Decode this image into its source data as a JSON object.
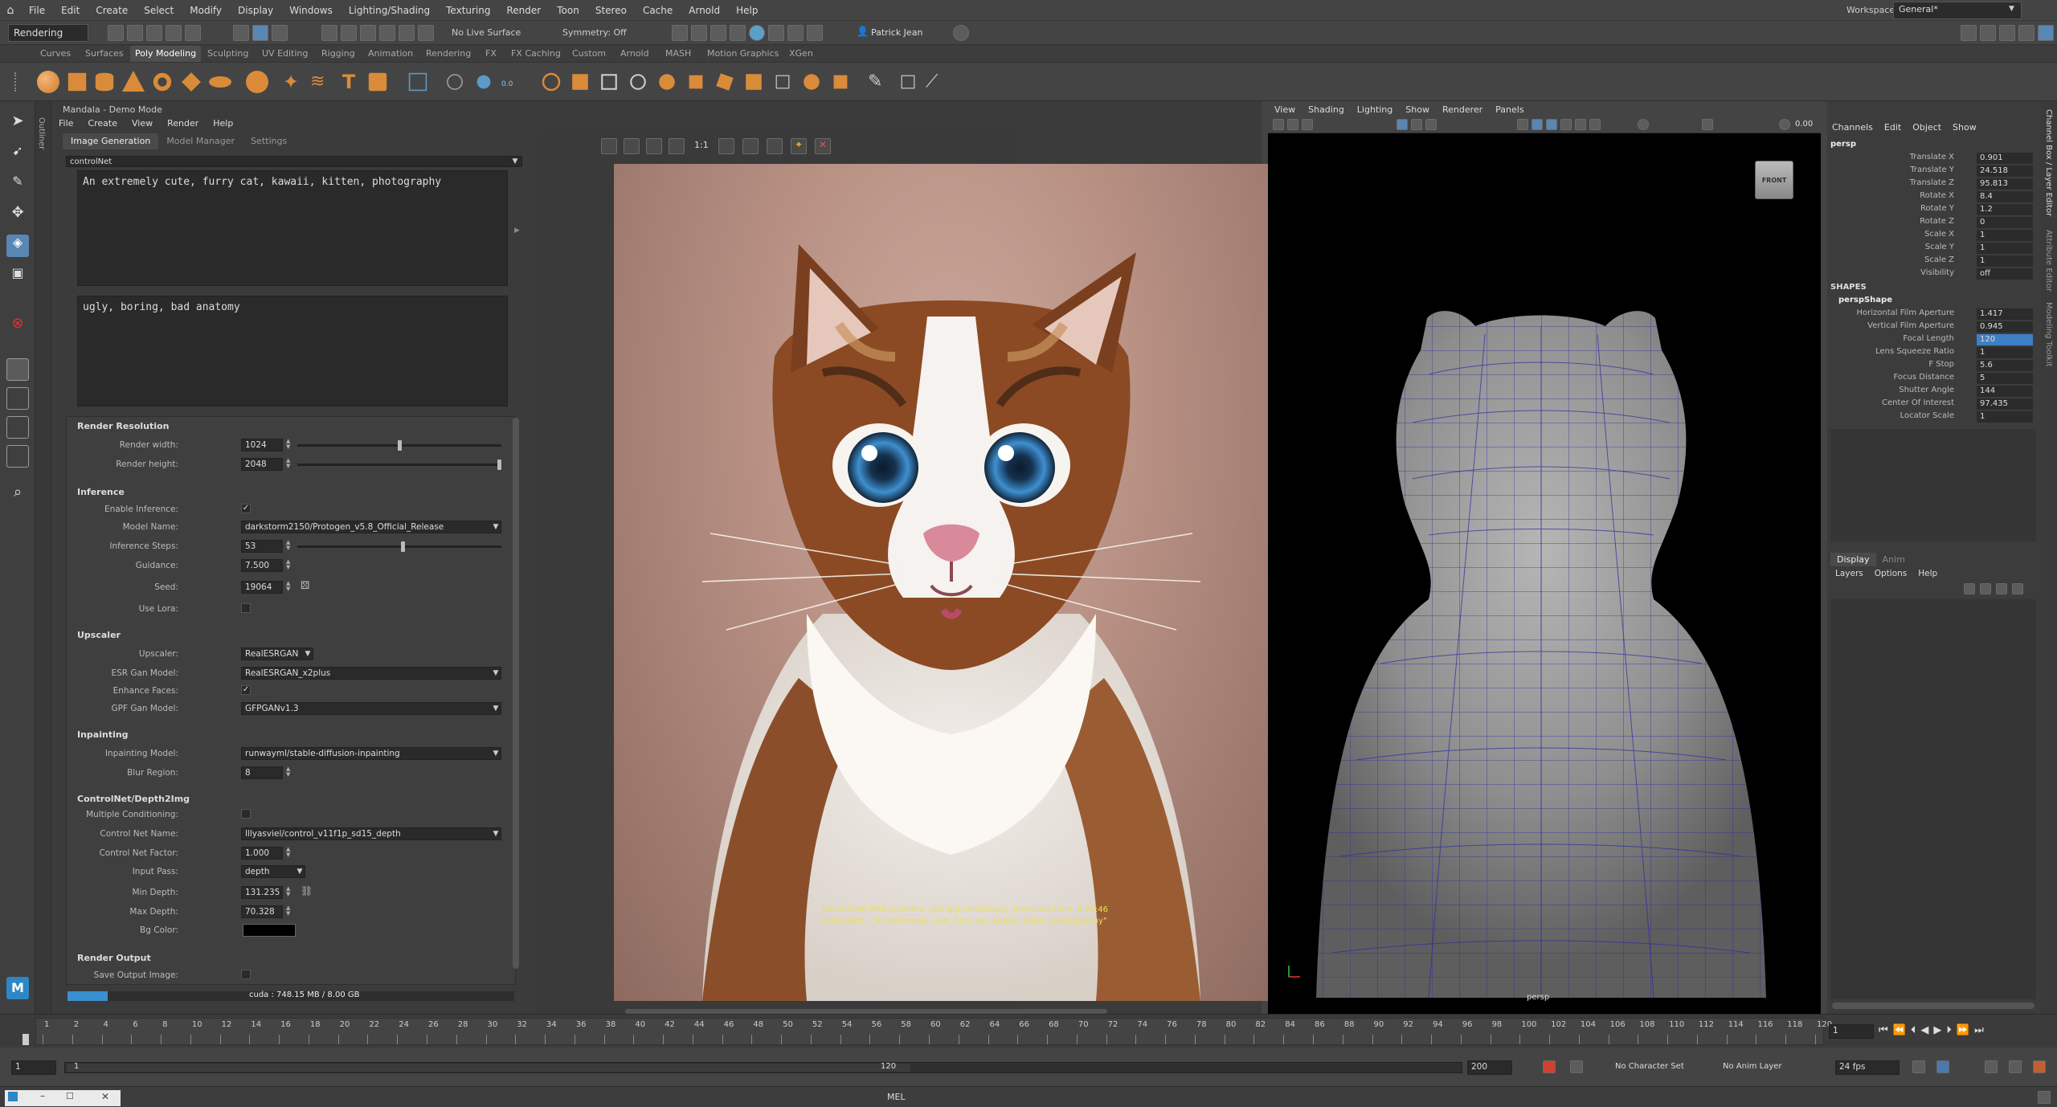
{
  "app": {
    "menu": [
      "File",
      "Edit",
      "Create",
      "Select",
      "Modify",
      "Display",
      "Windows",
      "Lighting/Shading",
      "Texturing",
      "Render",
      "Toon",
      "Stereo",
      "Cache",
      "Arnold",
      "Help"
    ],
    "workspace_label": "Workspace:",
    "workspace_value": "General*"
  },
  "statusline": {
    "mode": "Rendering",
    "live_surface": "No Live Surface",
    "symmetry": "Symmetry: Off",
    "user": "Patrick Jean"
  },
  "shelf_tabs": [
    "Curves",
    "Surfaces",
    "Poly Modeling",
    "Sculpting",
    "UV Editing",
    "Rigging",
    "Animation",
    "Rendering",
    "FX",
    "FX Caching",
    "Custom",
    "Arnold",
    "MASH",
    "Motion Graphics",
    "XGen"
  ],
  "shelf_active": "Poly Modeling",
  "shelf_badge": "0.0",
  "outliner_label": "Outliner",
  "toolbox_badge": "M",
  "mandala": {
    "title": "Mandala - Demo Mode",
    "menu": [
      "File",
      "Create",
      "View",
      "Render",
      "Help"
    ],
    "tabs": [
      "Image Generation",
      "Model Manager",
      "Settings"
    ],
    "preset": "controlNet",
    "prompt": "An extremely cute, furry cat, kawaii, kitten, photography",
    "negative_prompt": "ugly, boring, bad anatomy",
    "render_resolution": {
      "title": "Render Resolution",
      "width_label": "Render width:",
      "width": "1024",
      "width_level": 0.5,
      "height_label": "Render height:",
      "height": "2048",
      "height_level": 1.0
    },
    "inference": {
      "title": "Inference",
      "enable_label": "Enable Inference:",
      "enable": true,
      "model_label": "Model Name:",
      "model": "darkstorm2150/Protogen_v5.8_Official_Release",
      "steps_label": "Inference Steps:",
      "steps": "53",
      "steps_level": 0.52,
      "guidance_label": "Guidance:",
      "guidance": "7.500",
      "seed_label": "Seed:",
      "seed": "19064",
      "lora_label": "Use Lora:",
      "lora": false
    },
    "upscaler": {
      "title": "Upscaler",
      "upscaler_label": "Upscaler:",
      "upscaler": "RealESRGAN",
      "esr_label": "ESR Gan Model:",
      "esr": "RealESRGAN_x2plus",
      "faces_label": "Enhance Faces:",
      "faces": true,
      "gpf_label": "GPF Gan Model:",
      "gpf": "GFPGANv1.3"
    },
    "inpainting": {
      "title": "Inpainting",
      "model_label": "Inpainting Model:",
      "model": "runwayml/stable-diffusion-inpainting",
      "blur_label": "Blur Region:",
      "blur": "8"
    },
    "controlnet": {
      "title": "ControlNet/Depth2Img",
      "multi_label": "Multiple Conditioning:",
      "multi": false,
      "name_label": "Control Net Name:",
      "name": "lllyasviel/control_v11f1p_sd15_depth",
      "factor_label": "Control Net Factor:",
      "factor": "1.000",
      "pass_label": "Input Pass:",
      "pass": "depth",
      "min_label": "Min Depth:",
      "min": "131.235",
      "max_label": "Max Depth:",
      "max": "70.328",
      "bg_label": "Bg Color:",
      "bg": "#000000"
    },
    "render_output": {
      "title": "Render Output",
      "save_label": "Save Output Image:",
      "save": false
    },
    "memory": "cuda : 748.15 MB / 8.00 GB",
    "memory_level": 0.09,
    "zoom_label": "1:1",
    "overlay_line1": "1024x2048 RGB (Camera: /persp/perspShape). Inference time: 0:00:46",
    "overlay_line2": "controlNet : \"An extremely cute, furry cat, kawaii, kitten, photography\""
  },
  "viewport": {
    "menu": [
      "View",
      "Shading",
      "Lighting",
      "Show",
      "Renderer",
      "Panels"
    ],
    "readout": "0.00",
    "cube_label": "FRONT",
    "camera_label": "persp"
  },
  "channelbox": {
    "menu": [
      "Channels",
      "Edit",
      "Object",
      "Show"
    ],
    "object": "persp",
    "rows": [
      {
        "name": "Translate X",
        "value": "0.901"
      },
      {
        "name": "Translate Y",
        "value": "24.518"
      },
      {
        "name": "Translate Z",
        "value": "95.813"
      },
      {
        "name": "Rotate X",
        "value": "8.4"
      },
      {
        "name": "Rotate Y",
        "value": "1.2"
      },
      {
        "name": "Rotate Z",
        "value": "0"
      },
      {
        "name": "Scale X",
        "value": "1"
      },
      {
        "name": "Scale Y",
        "value": "1"
      },
      {
        "name": "Scale Z",
        "value": "1"
      },
      {
        "name": "Visibility",
        "value": "off"
      }
    ],
    "shapes_title": "SHAPES",
    "shape_name": "perspShape",
    "shape_rows": [
      {
        "name": "Horizontal Film Aperture",
        "value": "1.417"
      },
      {
        "name": "Vertical Film Aperture",
        "value": "0.945"
      },
      {
        "name": "Focal Length",
        "value": "120"
      },
      {
        "name": "Lens Squeeze Ratio",
        "value": "1"
      },
      {
        "name": "F Stop",
        "value": "5.6"
      },
      {
        "name": "Focus Distance",
        "value": "5"
      },
      {
        "name": "Shutter Angle",
        "value": "144"
      },
      {
        "name": "Center Of Interest",
        "value": "97.435"
      },
      {
        "name": "Locator Scale",
        "value": "1"
      }
    ],
    "layer_tabs": [
      "Display",
      "Anim"
    ],
    "layer_menu": [
      "Layers",
      "Options",
      "Help"
    ],
    "side_labels": [
      "Channel Box / Layer Editor",
      "Attribute Editor",
      "Modeling Toolkit"
    ]
  },
  "timeline": {
    "ticks": [
      "1",
      "2",
      "4",
      "6",
      "8",
      "10",
      "12",
      "14",
      "16",
      "18",
      "20",
      "22",
      "24",
      "26",
      "28",
      "30",
      "32",
      "34",
      "36",
      "38",
      "40",
      "42",
      "44",
      "46",
      "48",
      "50",
      "52",
      "54",
      "56",
      "58",
      "60",
      "62",
      "64",
      "66",
      "68",
      "70",
      "72",
      "74",
      "76",
      "78",
      "80",
      "82",
      "84",
      "86",
      "88",
      "90",
      "92",
      "94",
      "96",
      "98",
      "100",
      "102",
      "104",
      "106",
      "108",
      "110",
      "112",
      "114",
      "116",
      "118",
      "120"
    ],
    "current": "1",
    "range_start": "1",
    "range_start_inner": "1",
    "range_end_inner": "120",
    "range_end": "200",
    "char_set": "No Character Set",
    "anim_layer": "No Anim Layer",
    "fps": "24 fps"
  },
  "cmdline": {
    "label": "MEL"
  }
}
